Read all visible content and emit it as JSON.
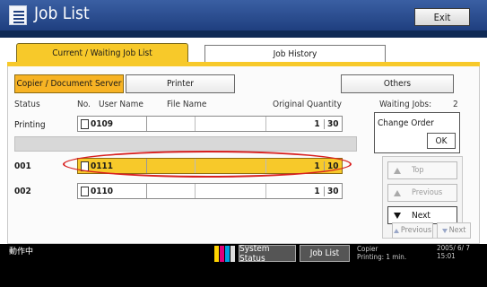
{
  "header": {
    "title": "Job List",
    "exit_label": "Exit"
  },
  "tabs": [
    {
      "label": "Current / Waiting Job List",
      "active": true
    },
    {
      "label": "Job History",
      "active": false
    }
  ],
  "filters": {
    "copier": "Copier / Document Server",
    "printer": "Printer",
    "others": "Others"
  },
  "columns": {
    "status": "Status",
    "no": "No.",
    "user": "User Name",
    "file": "File Name",
    "quantity": "Original Quantity"
  },
  "waiting": {
    "label": "Waiting Jobs:",
    "count": "2"
  },
  "printing": {
    "status": "Printing",
    "job_no": "0109",
    "originals": "1",
    "quantity": "30"
  },
  "jobs": [
    {
      "order": "001",
      "job_no": "0111",
      "originals": "1",
      "quantity": "10",
      "selected": true
    },
    {
      "order": "002",
      "job_no": "0110",
      "originals": "1",
      "quantity": "30",
      "selected": false
    }
  ],
  "right_panel": {
    "change_order": "Change Order",
    "ok": "OK",
    "top": "Top",
    "previous": "Previous",
    "next": "Next"
  },
  "pager": {
    "previous": "Previous",
    "next": "Next"
  },
  "status_bar": {
    "left_text": "動作中",
    "system_status": "System Status",
    "job_list": "Job List",
    "mode_line1": "Copier",
    "mode_line2": "Printing: 1 min.",
    "date": "2005/ 6/ 7",
    "time": "15:01"
  },
  "colors": {
    "accent_yellow": "#f7c92a",
    "header_blue": "#2a4b8f",
    "highlight_red": "#d82020"
  }
}
